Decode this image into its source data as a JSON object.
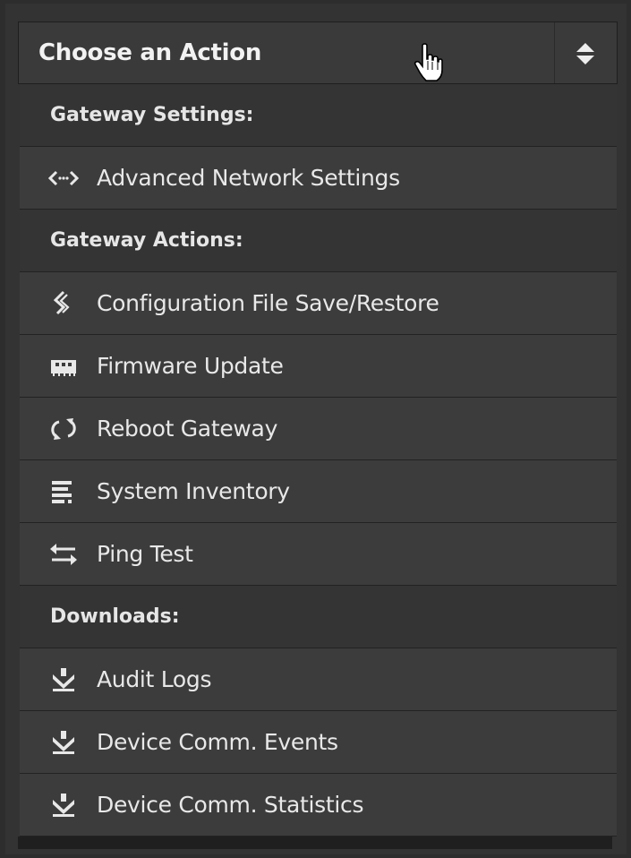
{
  "select": {
    "label": "Choose an Action"
  },
  "menu": {
    "sections": [
      {
        "header": "Gateway Settings:",
        "items": [
          {
            "label": "Advanced Network Settings",
            "icon": "code-arrows-icon"
          }
        ]
      },
      {
        "header": "Gateway Actions:",
        "items": [
          {
            "label": "Configuration File Save/Restore",
            "icon": "config-file-icon"
          },
          {
            "label": "Firmware Update",
            "icon": "chip-icon"
          },
          {
            "label": "Reboot Gateway",
            "icon": "refresh-icon"
          },
          {
            "label": "System Inventory",
            "icon": "list-icon"
          },
          {
            "label": "Ping Test",
            "icon": "exchange-arrows-icon"
          }
        ]
      },
      {
        "header": "Downloads:",
        "items": [
          {
            "label": "Audit Logs",
            "icon": "download-icon"
          },
          {
            "label": "Device Comm. Events",
            "icon": "download-icon"
          },
          {
            "label": "Device Comm. Statistics",
            "icon": "download-icon"
          }
        ]
      }
    ]
  },
  "colors": {
    "background": "#333333",
    "header_row": "#343434",
    "item_row": "#3c3c3c",
    "text": "#e8e8e8"
  }
}
